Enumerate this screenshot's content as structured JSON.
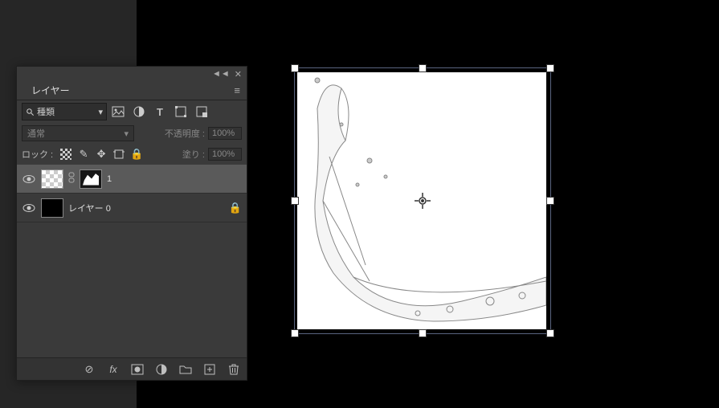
{
  "panel": {
    "tab_title": "レイヤー",
    "menu_glyph": "≡",
    "collapse_glyph": "◄◄",
    "close_glyph": "✕"
  },
  "filter": {
    "search_icon_name": "search-icon",
    "search_text": "種類",
    "caret_glyph": "▾"
  },
  "blend": {
    "mode": "通常",
    "opacity_label": "不透明度 :",
    "opacity_value": "100%"
  },
  "lock": {
    "label": "ロック :",
    "fill_label": "塗り :",
    "fill_value": "100%"
  },
  "layers": [
    {
      "name": "1",
      "selected": true,
      "has_mask": true,
      "locked": false,
      "thumb": "checker"
    },
    {
      "name": "レイヤー 0",
      "selected": false,
      "has_mask": false,
      "locked": true,
      "thumb": "black"
    }
  ],
  "footer_icons": {
    "link": "⊘",
    "fx": "fx",
    "mask": "◻",
    "adjust": "◐",
    "group": "▣",
    "new": "⊞",
    "trash": "🗑"
  }
}
